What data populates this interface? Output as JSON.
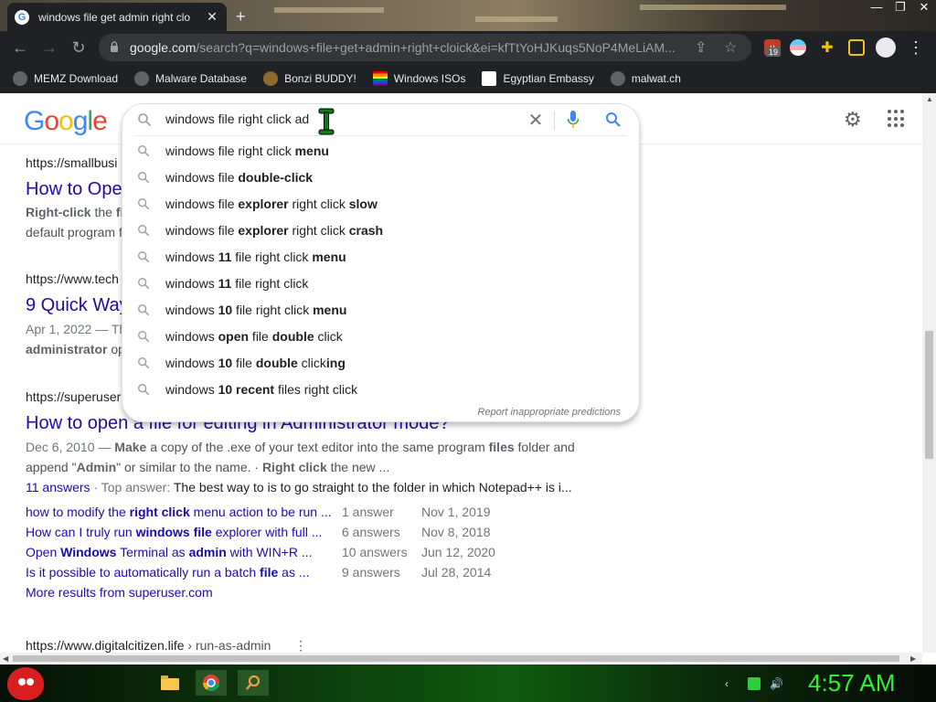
{
  "browser": {
    "tab_title": "windows file get admin right clo",
    "tab_close": "✕",
    "new_tab": "+",
    "url_host": "google.com",
    "url_path": "/search?q=windows+file+get+admin+right+cloick&ei=kfTtYoHJKuqs5NoP4MeLiAM...",
    "extension_badge": "19",
    "bookmarks": [
      {
        "label": "MEMZ Download"
      },
      {
        "label": "Malware Database"
      },
      {
        "label": "Bonzi BUDDY!"
      },
      {
        "label": "Windows ISOs"
      },
      {
        "label": "Egyptian Embassy"
      },
      {
        "label": "malwat.ch"
      }
    ]
  },
  "google": {
    "logo": [
      "G",
      "o",
      "o",
      "g",
      "l",
      "e"
    ],
    "search_value": "windows file right click ad",
    "suggestions": [
      {
        "pre": "windows file right click ",
        "bold": "menu",
        "post": ""
      },
      {
        "pre": "windows file ",
        "bold": "double-click",
        "post": ""
      },
      {
        "pre": "windows file ",
        "bold": "explorer",
        "post": " right click ",
        "bold2": "slow"
      },
      {
        "pre": "windows file ",
        "bold": "explorer",
        "post": " right click ",
        "bold2": "crash"
      },
      {
        "pre": "windows ",
        "bold": "11",
        "post": " file right click ",
        "bold2": "menu"
      },
      {
        "pre": "windows ",
        "bold": "11",
        "post": " file right click",
        "bold2": ""
      },
      {
        "pre": "windows ",
        "bold": "10",
        "post": " file right click ",
        "bold2": "menu"
      },
      {
        "pre": "windows ",
        "bold": "open",
        "post": " file ",
        "bold2": "double",
        "post2": " click"
      },
      {
        "pre": "windows ",
        "bold": "10",
        "post": " file ",
        "bold2": "double",
        "post2": " click",
        "bold3": "ing"
      },
      {
        "pre": "windows ",
        "bold": "10 recent",
        "post": " files right click",
        "bold2": ""
      }
    ],
    "report_link": "Report inappropriate predictions",
    "results": {
      "r1": {
        "cite": "https://smallbusi",
        "title": "How to Ope",
        "snip1_b": "Right-click",
        "snip1": " the ",
        "snip1_b2": "fil",
        "snip2": "default program f"
      },
      "r2": {
        "cite": "https://www.tech",
        "title": "9 Quick Way",
        "snip1": "Apr 1, 2022 — Th",
        "snip2_b": "administrator",
        "snip2": " opt"
      },
      "r3": {
        "cite": "https://superuser",
        "title": "How to open a file for editing in Administrator mode?",
        "date": "Dec 6, 2010 —",
        "snip1_b": "Make",
        "snip1": " a copy of the .exe of your text editor into the same program ",
        "snip1_b2": "files",
        "snip1_end": " folder and",
        "snip2a": "append \"",
        "snip2_b": "Admin",
        "snip2b": "\" or similar to the name. · ",
        "snip2_b2": "Right click",
        "snip2c": " the new ...",
        "answers_label": "11 answers",
        "top_answer": " · Top answer: ",
        "top_answer_text": "The best way to is to go straight to the folder in which Notepad++ is i...",
        "sub": [
          {
            "t1": "how to modify the ",
            "b": "right click",
            "t2": " menu action to be run ...",
            "answers": "1 answer",
            "date": "Nov 1, 2019"
          },
          {
            "t1": "How can I truly run ",
            "b": "windows file",
            "t2": " explorer with full ...",
            "answers": "6 answers",
            "date": "Nov 8, 2018"
          },
          {
            "t1": "Open ",
            "b": "Windows",
            "t2": " Terminal as ",
            "b2": "admin",
            "t3": " with WIN+R ...",
            "answers": "10 answers",
            "date": "Jun 12, 2020"
          },
          {
            "t1": "Is it possible to automatically run a batch ",
            "b": "file",
            "t2": " as ...",
            "answers": "9 answers",
            "date": "Jul 28, 2014"
          }
        ],
        "more": "More results from superuser.com"
      },
      "r4": {
        "cite": "https://www.digitalcitizen.life",
        "cite_path": " › run-as-admin",
        "kebab": "⋮"
      }
    }
  },
  "taskbar": {
    "clock": "4:57 AM"
  }
}
